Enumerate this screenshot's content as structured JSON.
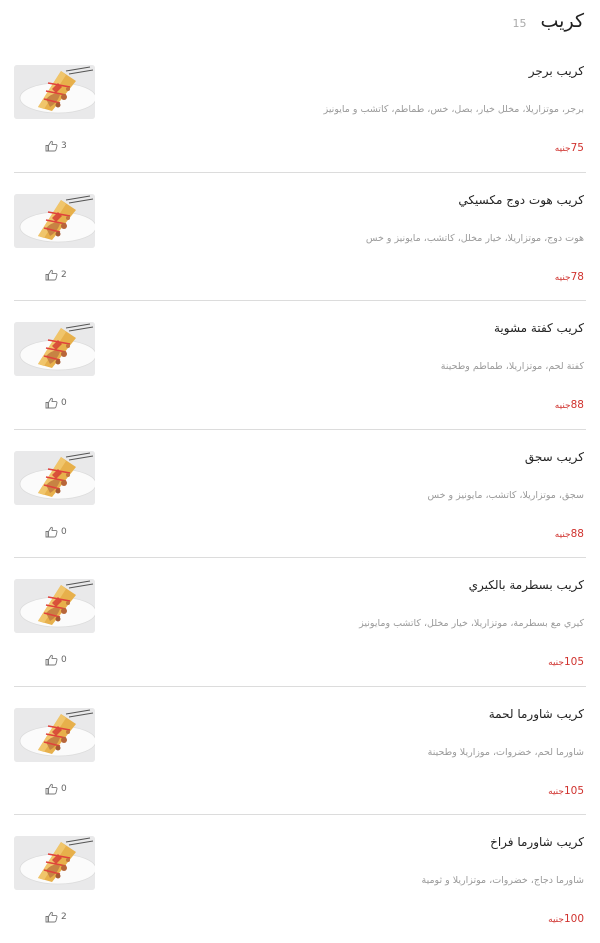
{
  "header": {
    "title": "كريب",
    "count": "15"
  },
  "currency": "جنيه",
  "items": [
    {
      "name": "كريب برجر",
      "description": "برجر، موتزاريلا، مخلل خيار، بصل، خس، طماطم، كاتشب و مايونيز",
      "price": "75",
      "likes": "3"
    },
    {
      "name": "كريب هوت دوج مكسيكي",
      "description": "هوت دوج، موتزاريلا، خيار مخلل، كاتشب، مايونيز و خس",
      "price": "78",
      "likes": "2"
    },
    {
      "name": "كريب كفتة مشوية",
      "description": "كفتة لحم، موتزاريلا، طماطم وطحينة",
      "price": "88",
      "likes": "0"
    },
    {
      "name": "كريب سجق",
      "description": "سجق، موتزاريلا، كاتشب، مايونيز و خس",
      "price": "88",
      "likes": "0"
    },
    {
      "name": "كريب بسطرمة بالكيري",
      "description": "كيري مع بسطرمة، موتزاريلا، خيار مخلل، كاتشب ومايونيز",
      "price": "105",
      "likes": "0"
    },
    {
      "name": "كريب شاورما لحمة",
      "description": "شاورما لحم، خضروات، موزاريلا وطحينة",
      "price": "105",
      "likes": "0"
    },
    {
      "name": "كريب شاورما فراخ",
      "description": "شاورما دجاج، خضروات، موتزاريلا و ثومية",
      "price": "100",
      "likes": "2"
    }
  ]
}
